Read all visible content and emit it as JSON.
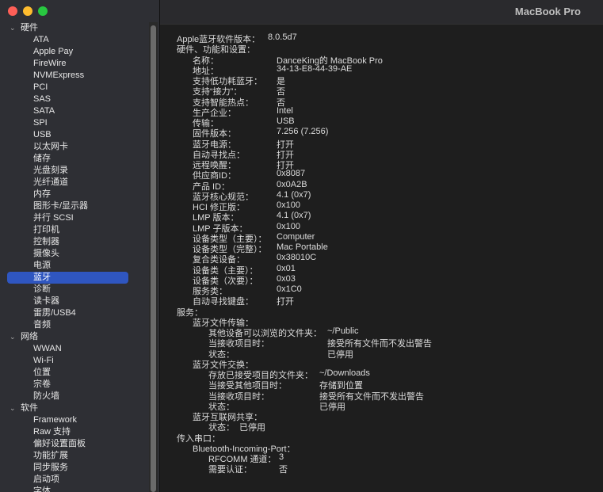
{
  "window": {
    "title": "MacBook Pro"
  },
  "sidebar": {
    "categories": [
      {
        "label": "硬件",
        "items": [
          "ATA",
          "Apple Pay",
          "FireWire",
          "NVMExpress",
          "PCI",
          "SAS",
          "SATA",
          "SPI",
          "USB",
          "以太网卡",
          "储存",
          "光盘刻录",
          "光纤通道",
          "内存",
          "图形卡/显示器",
          "并行 SCSI",
          "打印机",
          "控制器",
          "摄像头",
          "电源",
          "蓝牙",
          "诊断",
          "读卡器",
          "雷雳/USB4",
          "音频"
        ]
      },
      {
        "label": "网络",
        "items": [
          "WWAN",
          "Wi-Fi",
          "位置",
          "宗卷",
          "防火墙"
        ]
      },
      {
        "label": "软件",
        "items": [
          "Framework",
          "Raw 支持",
          "偏好设置面板",
          "功能扩展",
          "同步服务",
          "启动项",
          "字体"
        ]
      }
    ],
    "selected": "蓝牙",
    "chevron_glyph": "⌄"
  },
  "detail": {
    "rows": [
      {
        "k": "Apple蓝牙软件版本：",
        "v": "8.0.5d7"
      },
      {
        "k": "硬件、功能和设置：",
        "v": ""
      },
      {
        "k": "名称：",
        "v": "DanceKing的 MacBook Pro"
      },
      {
        "k": "地址：",
        "v": "34-13-E8-44-39-AE"
      },
      {
        "k": "支持低功耗蓝牙：",
        "v": "是"
      },
      {
        "k": "支持“接力”：",
        "v": "否"
      },
      {
        "k": "支持智能热点：",
        "v": "否"
      },
      {
        "k": "生产企业：",
        "v": "Intel"
      },
      {
        "k": "传输：",
        "v": "USB"
      },
      {
        "k": "固件版本：",
        "v": "7.256 (7.256)"
      },
      {
        "k": "蓝牙电源：",
        "v": "打开"
      },
      {
        "k": "自动寻找点：",
        "v": "打开"
      },
      {
        "k": "远程唤醒：",
        "v": "打开"
      },
      {
        "k": "供应商ID：",
        "v": "0x8087"
      },
      {
        "k": "产品 ID：",
        "v": "0x0A2B"
      },
      {
        "k": "蓝牙核心规范：",
        "v": "4.1 (0x7)"
      },
      {
        "k": "HCI 修正版：",
        "v": "0x100"
      },
      {
        "k": "LMP 版本：",
        "v": "4.1 (0x7)"
      },
      {
        "k": "LMP 子版本：",
        "v": "0x100"
      },
      {
        "k": "设备类型（主要）：",
        "v": "Computer"
      },
      {
        "k": "设备类型（完整）：",
        "v": "Mac Portable"
      },
      {
        "k": "复合类设备：",
        "v": "0x38010C"
      },
      {
        "k": "设备类（主要）：",
        "v": "0x01"
      },
      {
        "k": "设备类（次要）：",
        "v": "0x03"
      },
      {
        "k": "服务类：",
        "v": "0x1C0"
      },
      {
        "k": "自动寻找键盘：",
        "v": "打开"
      },
      {
        "k": "服务：",
        "v": ""
      },
      {
        "k": "蓝牙文件传输：",
        "v": ""
      },
      {
        "k": "其他设备可以浏览的文件夹：",
        "v": "~/Public"
      },
      {
        "k": "当接收项目时：",
        "v": "接受所有文件而不发出警告"
      },
      {
        "k": "状态：",
        "v": "已停用"
      },
      {
        "k": "蓝牙文件交换：",
        "v": ""
      },
      {
        "k": "存放已接受项目的文件夹：",
        "v": "~/Downloads"
      },
      {
        "k": "当接受其他项目时：",
        "v": "存储到位置"
      },
      {
        "k": "当接收项目时：",
        "v": "接受所有文件而不发出警告"
      },
      {
        "k": "状态：",
        "v": "已停用"
      },
      {
        "k": "蓝牙互联网共享：",
        "v": ""
      },
      {
        "k": "状态：",
        "v": "已停用"
      },
      {
        "k": "传入串口：",
        "v": ""
      },
      {
        "k": "Bluetooth-Incoming-Port：",
        "v": ""
      },
      {
        "k": "RFCOMM 通道：",
        "v": "3"
      },
      {
        "k": "需要认证：",
        "v": "否"
      }
    ]
  }
}
